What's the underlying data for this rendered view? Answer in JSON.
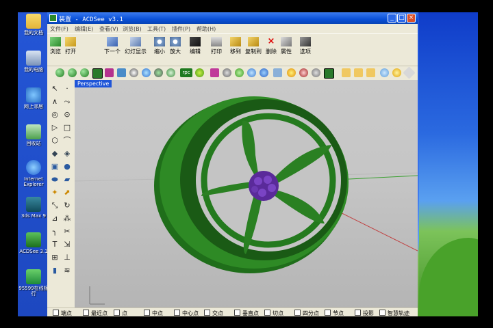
{
  "desktop": {
    "icons": [
      {
        "label": "我的文档",
        "icon": "folder-icon"
      },
      {
        "label": "我的电脑",
        "icon": "computer-icon"
      },
      {
        "label": "网上邻居",
        "icon": "network-icon"
      },
      {
        "label": "回收站",
        "icon": "recycle-bin-icon"
      },
      {
        "label": "Internet Explorer",
        "icon": "ie-icon"
      },
      {
        "label": "3ds Max 9",
        "icon": "3dsmax-icon"
      },
      {
        "label": "ACDSee 3.1",
        "icon": "acdsee-icon"
      },
      {
        "label": "95599在线银行",
        "icon": "bank-icon"
      }
    ]
  },
  "window": {
    "title": "装置 - ACDSee v3.1",
    "accent": "#0a50d8",
    "menu": [
      "文件(F)",
      "编辑(E)",
      "查看(V)",
      "浏览(B)",
      "工具(T)",
      "插件(P)",
      "帮助(H)"
    ],
    "toolbar": [
      {
        "label": "浏览",
        "icon": "browse-icon"
      },
      {
        "label": "打开",
        "icon": "open-icon"
      },
      {
        "label": "下一个",
        "icon": "next-icon"
      },
      {
        "label": "幻灯显示",
        "icon": "slideshow-icon"
      },
      {
        "label": "缩小",
        "icon": "zoom-out-icon"
      },
      {
        "label": "放大",
        "icon": "zoom-in-icon"
      },
      {
        "label": "编辑",
        "icon": "edit-icon"
      },
      {
        "label": "打印",
        "icon": "print-icon"
      },
      {
        "label": "移到",
        "icon": "move-icon"
      },
      {
        "label": "复制到",
        "icon": "copy-icon"
      },
      {
        "label": "删除",
        "icon": "delete-icon"
      },
      {
        "label": "属性",
        "icon": "properties-icon"
      },
      {
        "label": "选项",
        "icon": "options-icon"
      }
    ],
    "render_toolbar_rpc": "rpc",
    "viewport": {
      "label": "Perspective",
      "wheel_color": "#2e8a25",
      "hub_color": "#6b2fa8"
    },
    "snaps": [
      "端点",
      "最近点",
      "点",
      "中点",
      "中心点",
      "交点",
      "垂直点",
      "切点",
      "四分点",
      "节点",
      "投影",
      "智慧轨迹"
    ]
  }
}
